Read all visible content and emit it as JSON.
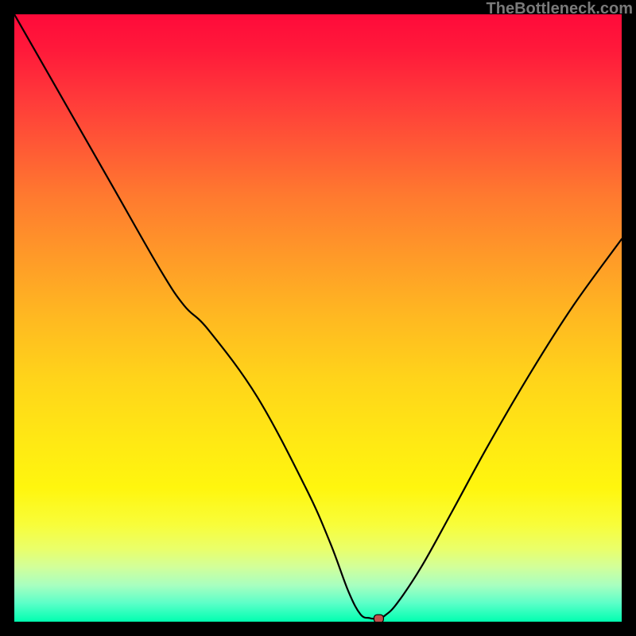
{
  "watermark": "TheBottleneck.com",
  "colors": {
    "frame_bg": "#000000",
    "curve_stroke": "#000000",
    "marker_fill": "#c0504d",
    "gradient_top": "#ff0a3a",
    "gradient_bottom": "#00ffb0"
  },
  "chart_data": {
    "type": "line",
    "title": "",
    "xlabel": "",
    "ylabel": "",
    "xlim": [
      0,
      100
    ],
    "ylim": [
      0,
      100
    ],
    "annotations": [],
    "legend": false,
    "grid": false,
    "series": [
      {
        "name": "bottleneck-curve",
        "x": [
          0,
          8,
          16,
          24,
          28,
          32,
          40,
          48,
          52,
          55,
          57,
          58.5,
          59,
          60,
          61,
          63,
          67,
          72,
          78,
          85,
          92,
          100
        ],
        "y": [
          100,
          86,
          72,
          58,
          52,
          48,
          37,
          22,
          13,
          5,
          1.2,
          0.6,
          0.5,
          0.5,
          1,
          3,
          9,
          18,
          29,
          41,
          52,
          63
        ]
      }
    ],
    "marker": {
      "x": 60,
      "y": 0.5,
      "shape": "rounded-rect",
      "color": "#c0504d"
    },
    "flat_min_range_x": [
      57.5,
      60.5
    ],
    "description": "V-shaped bottleneck curve over a vertical red-to-green gradient; steep descent from top-left, near-flat minimum around x≈59-60, then rises to the right edge."
  }
}
